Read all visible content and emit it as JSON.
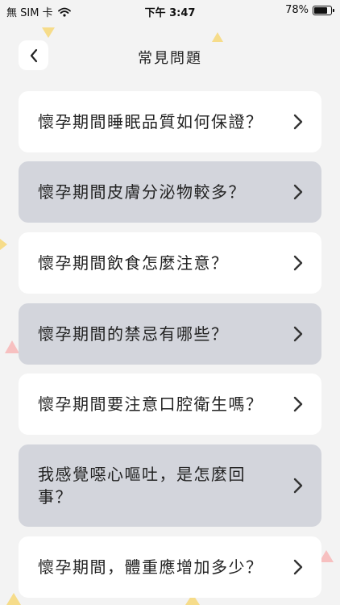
{
  "status_bar": {
    "carrier": "無 SIM 卡",
    "time": "下午 3:47",
    "battery": "78%",
    "battery_level": 0.78
  },
  "header": {
    "back_icon": "chevron-left-icon",
    "title": "常見問題"
  },
  "faq": [
    {
      "label": "懷孕期間睡眠品質如何保證？",
      "style": "light"
    },
    {
      "label": "懷孕期間皮膚分泌物較多？",
      "style": "dark"
    },
    {
      "label": "懷孕期間飲食怎麼注意？",
      "style": "light"
    },
    {
      "label": "懷孕期間的禁忌有哪些？",
      "style": "dark"
    },
    {
      "label": "懷孕期間要注意口腔衛生嗎？",
      "style": "light"
    },
    {
      "label": "我感覺噁心嘔吐，是怎麼回事？",
      "style": "dark"
    },
    {
      "label": "懷孕期間，體重應增加多少？",
      "style": "light"
    }
  ],
  "colors": {
    "background": "#f3f3f3",
    "card_light": "#ffffff",
    "card_dark": "#d3d5dc",
    "deco_yellow": "#f6dc8a",
    "deco_pink": "#f7c0c0"
  }
}
